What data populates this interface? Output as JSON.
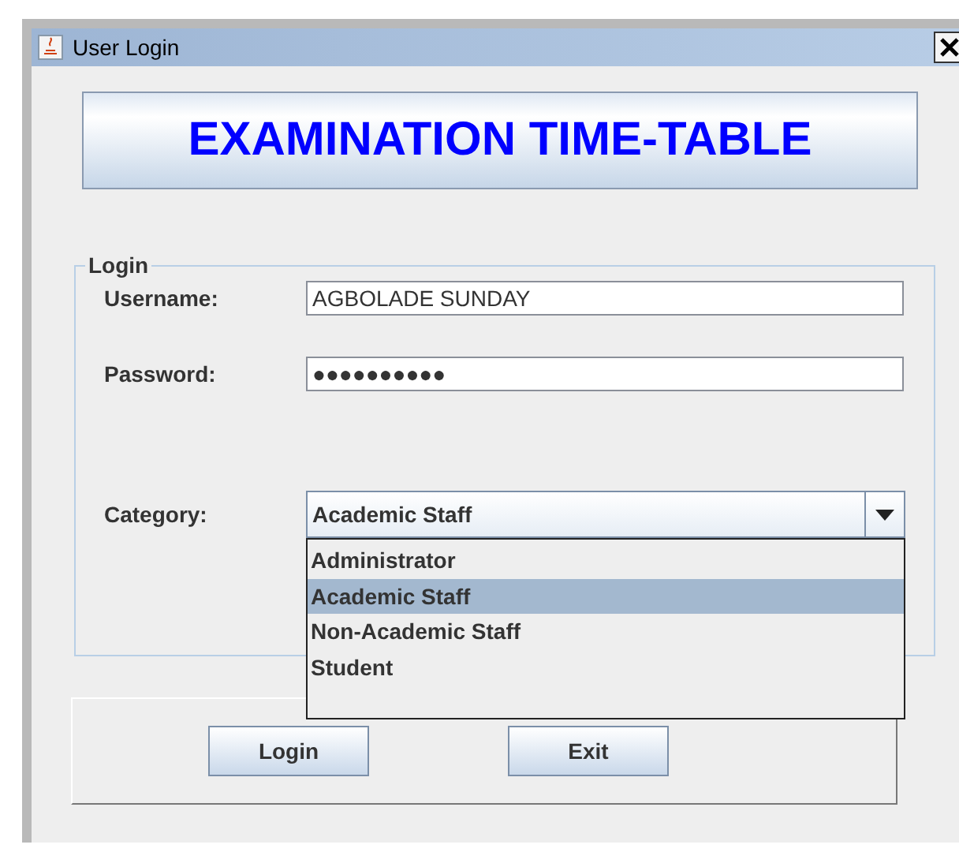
{
  "window": {
    "title": "User Login"
  },
  "banner": {
    "title": "EXAMINATION TIME-TABLE"
  },
  "login": {
    "legend": "Login",
    "username": {
      "label": "Username:",
      "value": "AGBOLADE SUNDAY"
    },
    "password": {
      "label": "Password:",
      "value": "●●●●●●●●●●"
    },
    "category": {
      "label": "Category:",
      "value": "Academic Staff",
      "expanded": true,
      "options": [
        {
          "label": "Administrator",
          "selected": false
        },
        {
          "label": "Academic Staff",
          "selected": true
        },
        {
          "label": "Non-Academic Staff",
          "selected": false
        },
        {
          "label": "Student",
          "selected": false
        }
      ]
    }
  },
  "buttons": [
    "Login",
    "Exit"
  ]
}
